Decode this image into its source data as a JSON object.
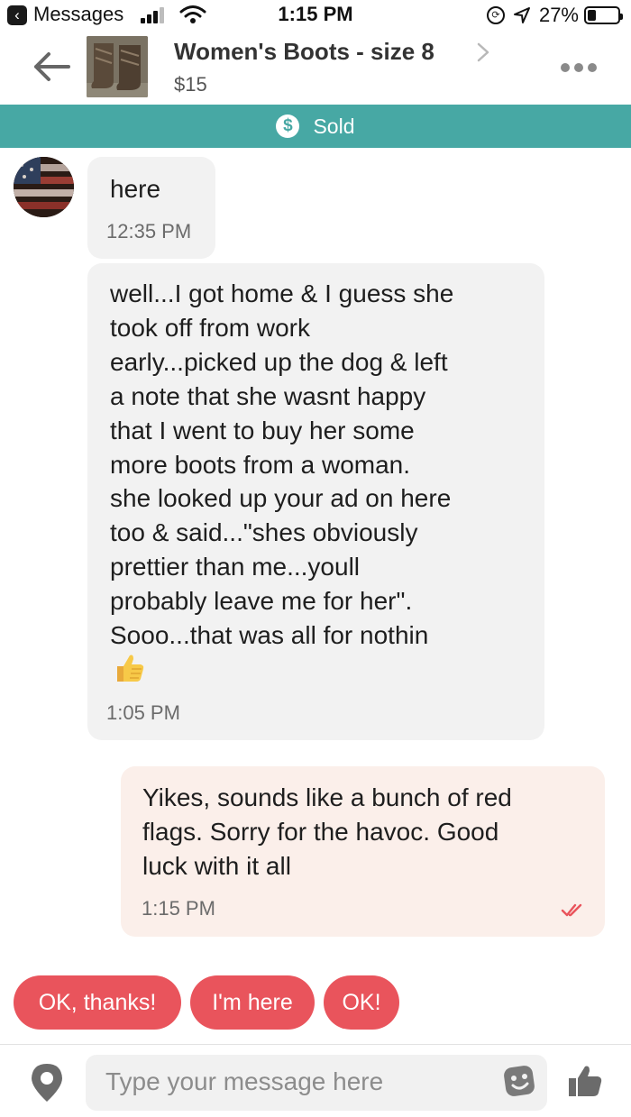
{
  "status_bar": {
    "app": "Messages",
    "time": "1:15 PM",
    "battery": "27%"
  },
  "listing": {
    "title": "Women's Boots - size 8",
    "price": "$15",
    "status": "Sold",
    "status_color": "#47a8a4"
  },
  "messages": [
    {
      "direction": "incoming",
      "text": "here",
      "time": "12:35 PM"
    },
    {
      "direction": "incoming",
      "text": "well...I got home & I guess she\ntook off from work\nearly...picked up the dog & left\na note that she wasnt happy\nthat I went to buy her some\nmore boots from a  woman.\nshe looked up your ad on here\ntoo & said...\"shes obviously\nprettier than me...youll\nprobably leave me for her\".\nSooo...that was all for nothin",
      "emoji": "thumbs-up",
      "time": "1:05 PM"
    },
    {
      "direction": "outgoing",
      "text": "Yikes, sounds like a bunch of red\nflags. Sorry for the havoc. Good\nluck with it all",
      "time": "1:15 PM",
      "read": true
    }
  ],
  "quick_replies": [
    "OK, thanks!",
    "I'm here",
    "OK!"
  ],
  "quick_reply_color": "#e9545c",
  "composer": {
    "placeholder": "Type your message here"
  },
  "icons": {
    "back": "back-arrow-icon",
    "more": "more-dots-icon",
    "sold": "dollar-icon",
    "location": "location-pin-icon",
    "sticker": "sticker-icon",
    "like": "thumbs-up-icon"
  }
}
